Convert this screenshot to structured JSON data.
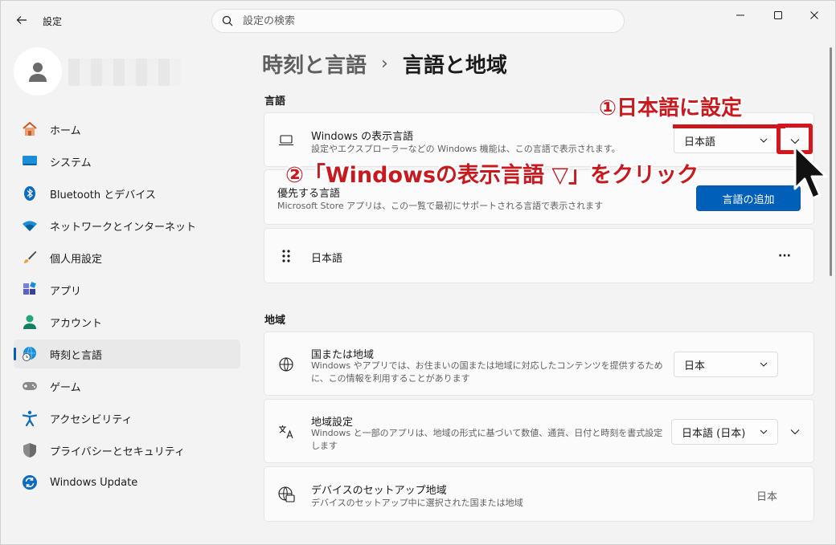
{
  "window": {
    "title": "設定"
  },
  "search": {
    "placeholder": "設定の検索"
  },
  "sidebar": {
    "items": [
      {
        "label": "ホーム"
      },
      {
        "label": "システム"
      },
      {
        "label": "Bluetooth とデバイス"
      },
      {
        "label": "ネットワークとインターネット"
      },
      {
        "label": "個人用設定"
      },
      {
        "label": "アプリ"
      },
      {
        "label": "アカウント"
      },
      {
        "label": "時刻と言語",
        "active": true
      },
      {
        "label": "ゲーム"
      },
      {
        "label": "アクセシビリティ"
      },
      {
        "label": "プライバシーとセキュリティ"
      },
      {
        "label": "Windows Update"
      }
    ]
  },
  "breadcrumb": {
    "parent": "時刻と言語",
    "separator": "›",
    "current": "言語と地域"
  },
  "language_section": {
    "title": "言語",
    "display_language": {
      "title": "Windows の表示言語",
      "description": "設定やエクスプローラーなどの Windows 機能は、この言語で表示されます。",
      "value": "日本語"
    },
    "preferred": {
      "title": "優先する言語",
      "description": "Microsoft Store アプリは、この一覧で最初にサポートされる言語で表示されます",
      "add_button": "言語の追加"
    },
    "installed": {
      "label": "日本語",
      "more": "···"
    }
  },
  "region_section": {
    "title": "地域",
    "country": {
      "title": "国または地域",
      "description": "Windows やアプリでは、お住まいの国または地域に対応したコンテンツを提供するために、この情報を利用することがあります",
      "value": "日本"
    },
    "regional_format": {
      "title": "地域設定",
      "description": "Windows と一部のアプリは、地域の形式に基づいて数値、通貨、日付と時刻を書式設定します",
      "value": "日本語 (日本)"
    },
    "setup_region": {
      "title": "デバイスのセットアップ地域",
      "description": "デバイスのセットアップ中に選択された国または地域",
      "value": "日本"
    }
  },
  "annotations": {
    "step1": "①日本語に設定",
    "step2": "②「Windowsの表示言語 ▽」をクリック"
  },
  "colors": {
    "accent": "#005fb8",
    "annotation": "#c8191f"
  }
}
